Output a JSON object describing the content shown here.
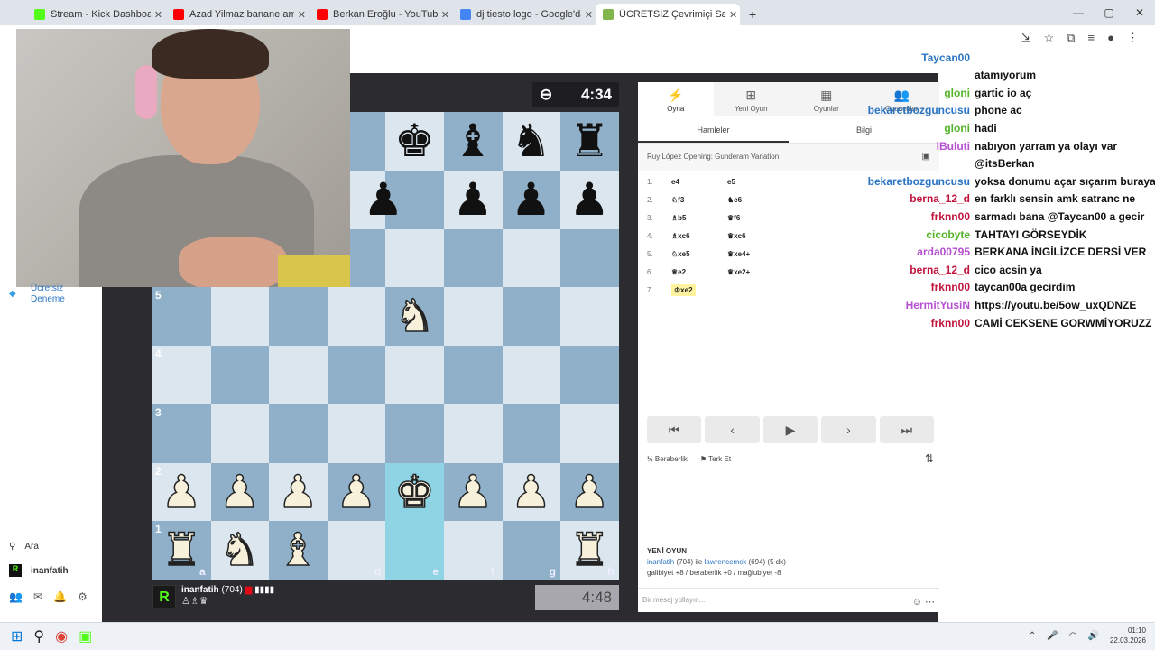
{
  "browser": {
    "tabs": [
      {
        "title": "Stream - Kick Dashboard",
        "color": "#53fc18"
      },
      {
        "title": "Azad Yilmaz banane amk - You",
        "color": "#ff0000"
      },
      {
        "title": "Berkan Eroğlu - YouTube",
        "color": "#ff0000"
      },
      {
        "title": "dj tiesto logo - Google'da Ara",
        "color": "#4285f4"
      },
      {
        "title": "ÜCRETSİZ Çevrimiçi Satranç Oy",
        "color": "#81b64c"
      }
    ],
    "new_tab": "+",
    "win": {
      "min": "—",
      "max": "▢",
      "close": "✕"
    }
  },
  "sidebar": {
    "cta": "Ücretsiz Deneme",
    "search": "Ara",
    "user": "inanfatih"
  },
  "game": {
    "opponent_clock": "4:34",
    "my_clock": "4:48",
    "player_name": "inanfatih",
    "player_rating": "(704)",
    "player_badges": "♙♗♛",
    "player_logo": "R",
    "ranks": [
      "5",
      "4",
      "3",
      "2",
      "1"
    ],
    "files": [
      "a",
      "d",
      "e",
      "f",
      "g",
      "h"
    ],
    "pieces": {
      "bk": "♚",
      "bb": "♝",
      "bn": "♞",
      "br": "♜",
      "bp": "♟",
      "wn": "♞",
      "wk": "♚",
      "wp": "♟",
      "wr": "♜",
      "wb": "♝"
    }
  },
  "panel": {
    "tabs": [
      "Oyna",
      "Yeni Oyun",
      "Oyunlar",
      "Oyuncular"
    ],
    "subtabs": [
      "Hamleler",
      "Bilgi"
    ],
    "opening": "Ruy López Opening: Gunderam Variation",
    "moves": [
      {
        "n": "1.",
        "w": "e4",
        "b": "e5"
      },
      {
        "n": "2.",
        "w": "♘f3",
        "b": "♞c6"
      },
      {
        "n": "3.",
        "w": "♗b5",
        "b": "♛f6"
      },
      {
        "n": "4.",
        "w": "♗xc6",
        "b": "♛xc6"
      },
      {
        "n": "5.",
        "w": "♘xe5",
        "b": "♛xe4+"
      },
      {
        "n": "6.",
        "w": "♕e2",
        "b": "♛xe2+"
      },
      {
        "n": "7.",
        "w": "♔xe2",
        "b": ""
      }
    ],
    "nav": [
      "⏮",
      "‹",
      "▶",
      "›",
      "⏭"
    ],
    "draw": "Beraberlik",
    "resign": "Terk Et",
    "newgame_title": "YENİ OYUN",
    "newgame_line1_user": "inanfatih",
    "newgame_line1_rest": " (704) ile ",
    "newgame_line1_opp": "lawrencemck",
    "newgame_line1_tail": " (694) (5 dk)",
    "newgame_line2": "galibiyet +8 / beraberlik +0 / mağlubiyet -8",
    "msg_placeholder": "Bir mesaj yollayın..."
  },
  "chat": [
    {
      "u": "",
      "m": "",
      "c": "#222"
    },
    {
      "u": "Taycan00",
      "m": "",
      "c": "#2a74c4"
    },
    {
      "u": "",
      "m": "atamıyorum",
      "c": "#222"
    },
    {
      "u": "gloni",
      "m": "gartic io aç",
      "c": "#53b32a"
    },
    {
      "u": "bekaretbozguncusu",
      "m": "phone ac",
      "c": "#2a74c4"
    },
    {
      "u": "gloni",
      "m": "hadi",
      "c": "#53b32a"
    },
    {
      "u": "lBuluti",
      "m": "nabıyon yarram ya olayı var",
      "c": "#b64fd0"
    },
    {
      "u": "",
      "m": "@itsBerkan",
      "c": "#222"
    },
    {
      "u": "bekaretbozguncusu",
      "m": "yoksa donumu açar sıçarım buraya",
      "c": "#2a74c4"
    },
    {
      "u": "berna_12_d",
      "m": "en farklı sensin amk satranc ne",
      "c": "#c0143c"
    },
    {
      "u": "frknn00",
      "m": "sarmadı bana @Taycan00 a gecir",
      "c": "#c0143c"
    },
    {
      "u": "cicobyte",
      "m": "TAHTAYI GÖRSEYDİK",
      "c": "#53b32a"
    },
    {
      "u": "arda00795",
      "m": "BERKANA İNGİLİZCE DERSİ VER",
      "c": "#b64fd0"
    },
    {
      "u": "berna_12_d",
      "m": "cico acsin ya",
      "c": "#c0143c"
    },
    {
      "u": "frknn00",
      "m": "taycan00a gecirdim",
      "c": "#c0143c"
    },
    {
      "u": "HermitYusiN",
      "m": "https://youtu.be/5ow_uxQDNZE",
      "c": "#b64fd0"
    },
    {
      "u": "frknn00",
      "m": "CAMİ CEKSENE GORWMİYORUZZ",
      "c": "#c0143c"
    }
  ],
  "taskbar": {
    "time": "01:10",
    "date": "22.03.2026"
  }
}
